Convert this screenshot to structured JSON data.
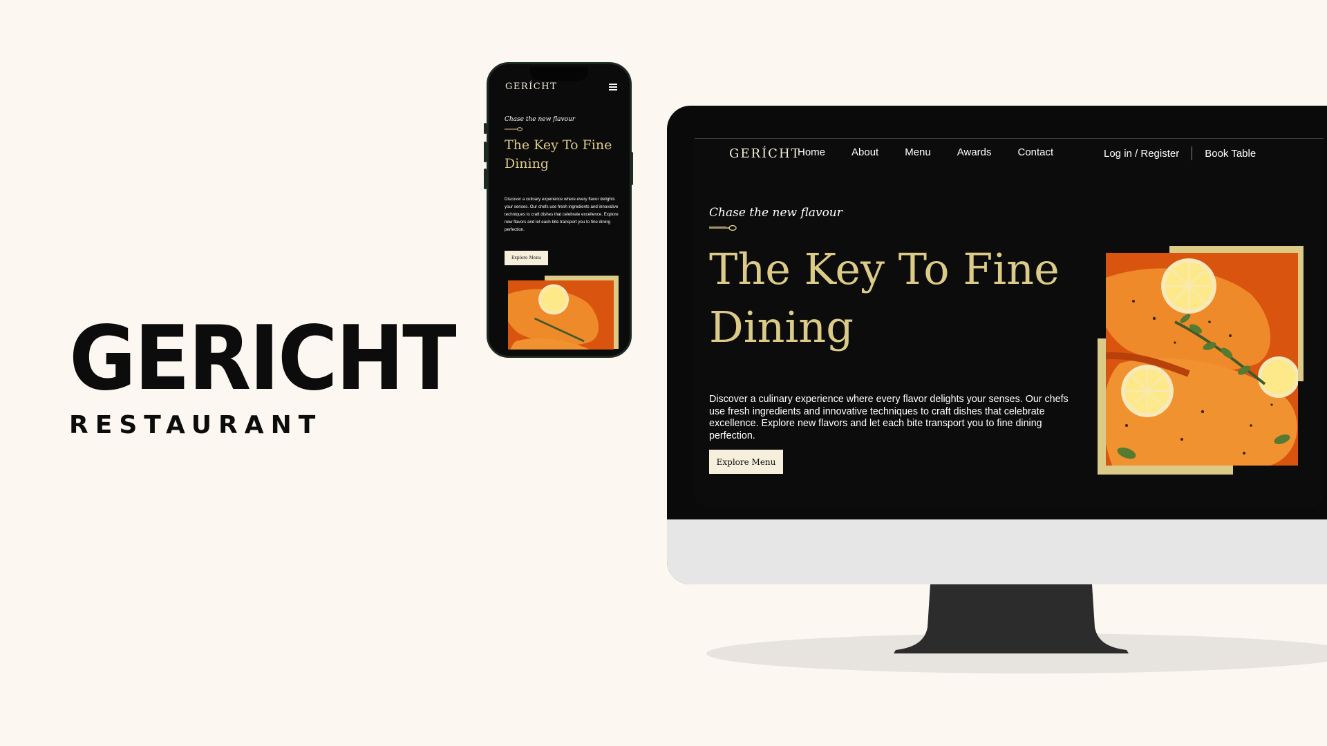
{
  "brand": {
    "name": "GERICHT",
    "tagline": "RESTAURANT"
  },
  "site": {
    "logo": "GERÍCHT",
    "nav": [
      "Home",
      "About",
      "Menu",
      "Awards",
      "Contact"
    ],
    "login": "Log in / Register",
    "book": "Book Table",
    "hero": {
      "subtitle": "Chase the new flavour",
      "title": "The Key To Fine Dining",
      "description": "Discover a culinary experience where every flavor delights your senses. Our chefs use fresh ingredients and innovative techniques to craft dishes that celebrate excellence. Explore new flavors and let each bite transport you to fine dining perfection.",
      "cta": "Explore Menu"
    }
  },
  "colors": {
    "background": "#fdf7f2",
    "gold": "#dcca87",
    "dark": "#0c0c0c",
    "cream": "#f5efdb",
    "food_orange": "#e8761f"
  }
}
